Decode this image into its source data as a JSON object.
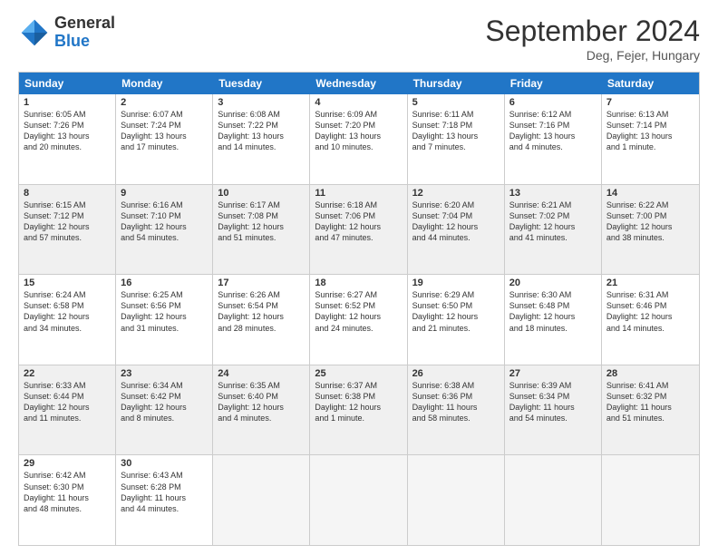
{
  "logo": {
    "general": "General",
    "blue": "Blue"
  },
  "header": {
    "title": "September 2024",
    "subtitle": "Deg, Fejer, Hungary"
  },
  "days": [
    "Sunday",
    "Monday",
    "Tuesday",
    "Wednesday",
    "Thursday",
    "Friday",
    "Saturday"
  ],
  "weeks": [
    [
      {
        "day": "1",
        "lines": [
          "Sunrise: 6:05 AM",
          "Sunset: 7:26 PM",
          "Daylight: 13 hours",
          "and 20 minutes."
        ]
      },
      {
        "day": "2",
        "lines": [
          "Sunrise: 6:07 AM",
          "Sunset: 7:24 PM",
          "Daylight: 13 hours",
          "and 17 minutes."
        ]
      },
      {
        "day": "3",
        "lines": [
          "Sunrise: 6:08 AM",
          "Sunset: 7:22 PM",
          "Daylight: 13 hours",
          "and 14 minutes."
        ]
      },
      {
        "day": "4",
        "lines": [
          "Sunrise: 6:09 AM",
          "Sunset: 7:20 PM",
          "Daylight: 13 hours",
          "and 10 minutes."
        ]
      },
      {
        "day": "5",
        "lines": [
          "Sunrise: 6:11 AM",
          "Sunset: 7:18 PM",
          "Daylight: 13 hours",
          "and 7 minutes."
        ]
      },
      {
        "day": "6",
        "lines": [
          "Sunrise: 6:12 AM",
          "Sunset: 7:16 PM",
          "Daylight: 13 hours",
          "and 4 minutes."
        ]
      },
      {
        "day": "7",
        "lines": [
          "Sunrise: 6:13 AM",
          "Sunset: 7:14 PM",
          "Daylight: 13 hours",
          "and 1 minute."
        ]
      }
    ],
    [
      {
        "day": "8",
        "lines": [
          "Sunrise: 6:15 AM",
          "Sunset: 7:12 PM",
          "Daylight: 12 hours",
          "and 57 minutes."
        ]
      },
      {
        "day": "9",
        "lines": [
          "Sunrise: 6:16 AM",
          "Sunset: 7:10 PM",
          "Daylight: 12 hours",
          "and 54 minutes."
        ]
      },
      {
        "day": "10",
        "lines": [
          "Sunrise: 6:17 AM",
          "Sunset: 7:08 PM",
          "Daylight: 12 hours",
          "and 51 minutes."
        ]
      },
      {
        "day": "11",
        "lines": [
          "Sunrise: 6:18 AM",
          "Sunset: 7:06 PM",
          "Daylight: 12 hours",
          "and 47 minutes."
        ]
      },
      {
        "day": "12",
        "lines": [
          "Sunrise: 6:20 AM",
          "Sunset: 7:04 PM",
          "Daylight: 12 hours",
          "and 44 minutes."
        ]
      },
      {
        "day": "13",
        "lines": [
          "Sunrise: 6:21 AM",
          "Sunset: 7:02 PM",
          "Daylight: 12 hours",
          "and 41 minutes."
        ]
      },
      {
        "day": "14",
        "lines": [
          "Sunrise: 6:22 AM",
          "Sunset: 7:00 PM",
          "Daylight: 12 hours",
          "and 38 minutes."
        ]
      }
    ],
    [
      {
        "day": "15",
        "lines": [
          "Sunrise: 6:24 AM",
          "Sunset: 6:58 PM",
          "Daylight: 12 hours",
          "and 34 minutes."
        ]
      },
      {
        "day": "16",
        "lines": [
          "Sunrise: 6:25 AM",
          "Sunset: 6:56 PM",
          "Daylight: 12 hours",
          "and 31 minutes."
        ]
      },
      {
        "day": "17",
        "lines": [
          "Sunrise: 6:26 AM",
          "Sunset: 6:54 PM",
          "Daylight: 12 hours",
          "and 28 minutes."
        ]
      },
      {
        "day": "18",
        "lines": [
          "Sunrise: 6:27 AM",
          "Sunset: 6:52 PM",
          "Daylight: 12 hours",
          "and 24 minutes."
        ]
      },
      {
        "day": "19",
        "lines": [
          "Sunrise: 6:29 AM",
          "Sunset: 6:50 PM",
          "Daylight: 12 hours",
          "and 21 minutes."
        ]
      },
      {
        "day": "20",
        "lines": [
          "Sunrise: 6:30 AM",
          "Sunset: 6:48 PM",
          "Daylight: 12 hours",
          "and 18 minutes."
        ]
      },
      {
        "day": "21",
        "lines": [
          "Sunrise: 6:31 AM",
          "Sunset: 6:46 PM",
          "Daylight: 12 hours",
          "and 14 minutes."
        ]
      }
    ],
    [
      {
        "day": "22",
        "lines": [
          "Sunrise: 6:33 AM",
          "Sunset: 6:44 PM",
          "Daylight: 12 hours",
          "and 11 minutes."
        ]
      },
      {
        "day": "23",
        "lines": [
          "Sunrise: 6:34 AM",
          "Sunset: 6:42 PM",
          "Daylight: 12 hours",
          "and 8 minutes."
        ]
      },
      {
        "day": "24",
        "lines": [
          "Sunrise: 6:35 AM",
          "Sunset: 6:40 PM",
          "Daylight: 12 hours",
          "and 4 minutes."
        ]
      },
      {
        "day": "25",
        "lines": [
          "Sunrise: 6:37 AM",
          "Sunset: 6:38 PM",
          "Daylight: 12 hours",
          "and 1 minute."
        ]
      },
      {
        "day": "26",
        "lines": [
          "Sunrise: 6:38 AM",
          "Sunset: 6:36 PM",
          "Daylight: 11 hours",
          "and 58 minutes."
        ]
      },
      {
        "day": "27",
        "lines": [
          "Sunrise: 6:39 AM",
          "Sunset: 6:34 PM",
          "Daylight: 11 hours",
          "and 54 minutes."
        ]
      },
      {
        "day": "28",
        "lines": [
          "Sunrise: 6:41 AM",
          "Sunset: 6:32 PM",
          "Daylight: 11 hours",
          "and 51 minutes."
        ]
      }
    ],
    [
      {
        "day": "29",
        "lines": [
          "Sunrise: 6:42 AM",
          "Sunset: 6:30 PM",
          "Daylight: 11 hours",
          "and 48 minutes."
        ]
      },
      {
        "day": "30",
        "lines": [
          "Sunrise: 6:43 AM",
          "Sunset: 6:28 PM",
          "Daylight: 11 hours",
          "and 44 minutes."
        ]
      },
      {
        "day": "",
        "lines": []
      },
      {
        "day": "",
        "lines": []
      },
      {
        "day": "",
        "lines": []
      },
      {
        "day": "",
        "lines": []
      },
      {
        "day": "",
        "lines": []
      }
    ]
  ]
}
